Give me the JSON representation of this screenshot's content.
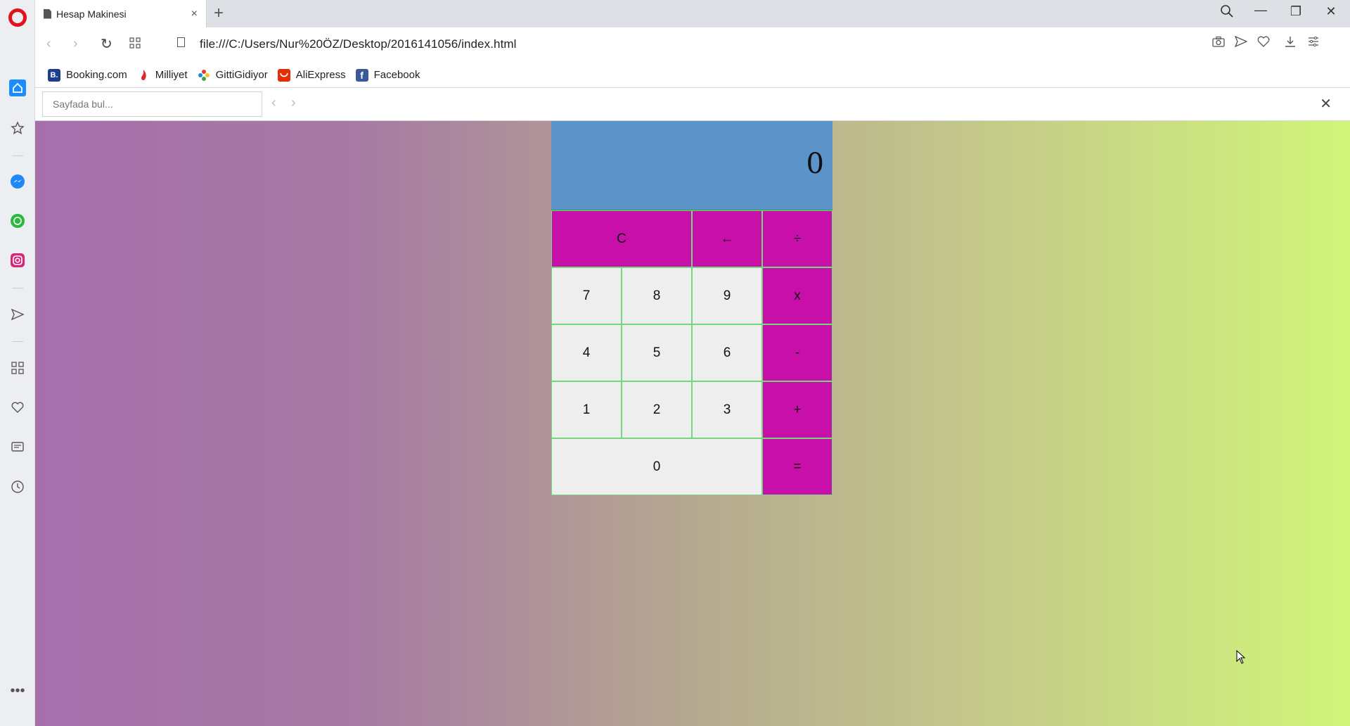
{
  "browser": {
    "tab": {
      "title": "Hesap Makinesi",
      "close": "×"
    },
    "new_tab": "+",
    "window_controls": {
      "search": "⌕",
      "minimize": "—",
      "restore": "❐",
      "close": "✕"
    },
    "address": {
      "url": "file:///C:/Users/Nur%20ÖZ/Desktop/2016141056/index.html"
    },
    "bookmarks": [
      {
        "label": "Booking.com",
        "icon": "booking-icon",
        "color": "#1e3d8f",
        "glyph": "B."
      },
      {
        "label": "Milliyet",
        "icon": "milliyet-icon",
        "color": "#e3262f",
        "glyph": ""
      },
      {
        "label": "GittiGidiyor",
        "icon": "gittigidiyor-icon",
        "color": "#f5a623",
        "glyph": ""
      },
      {
        "label": "AliExpress",
        "icon": "aliexpress-icon",
        "color": "#e62e04",
        "glyph": ""
      },
      {
        "label": "Facebook",
        "icon": "facebook-icon",
        "color": "#3b5998",
        "glyph": "f"
      }
    ],
    "find": {
      "placeholder": "Sayfada bul...",
      "close": "✕"
    }
  },
  "calculator": {
    "display": "0",
    "keys": [
      {
        "label": "C",
        "type": "op",
        "span": 2,
        "name": "clear"
      },
      {
        "label": "←",
        "type": "op",
        "span": 1,
        "name": "backspace"
      },
      {
        "label": "÷",
        "type": "op",
        "span": 1,
        "name": "divide"
      },
      {
        "label": "7",
        "type": "num",
        "span": 1,
        "name": "7"
      },
      {
        "label": "8",
        "type": "num",
        "span": 1,
        "name": "8"
      },
      {
        "label": "9",
        "type": "num",
        "span": 1,
        "name": "9"
      },
      {
        "label": "x",
        "type": "op",
        "span": 1,
        "name": "multiply"
      },
      {
        "label": "4",
        "type": "num",
        "span": 1,
        "name": "4"
      },
      {
        "label": "5",
        "type": "num",
        "span": 1,
        "name": "5"
      },
      {
        "label": "6",
        "type": "num",
        "span": 1,
        "name": "6"
      },
      {
        "label": "-",
        "type": "op",
        "span": 1,
        "name": "subtract"
      },
      {
        "label": "1",
        "type": "num",
        "span": 1,
        "name": "1"
      },
      {
        "label": "2",
        "type": "num",
        "span": 1,
        "name": "2"
      },
      {
        "label": "3",
        "type": "num",
        "span": 1,
        "name": "3"
      },
      {
        "label": "+",
        "type": "op",
        "span": 1,
        "name": "add"
      },
      {
        "label": "0",
        "type": "num",
        "span": 3,
        "name": "0"
      },
      {
        "label": "=",
        "type": "op",
        "span": 1,
        "name": "equals"
      }
    ]
  }
}
